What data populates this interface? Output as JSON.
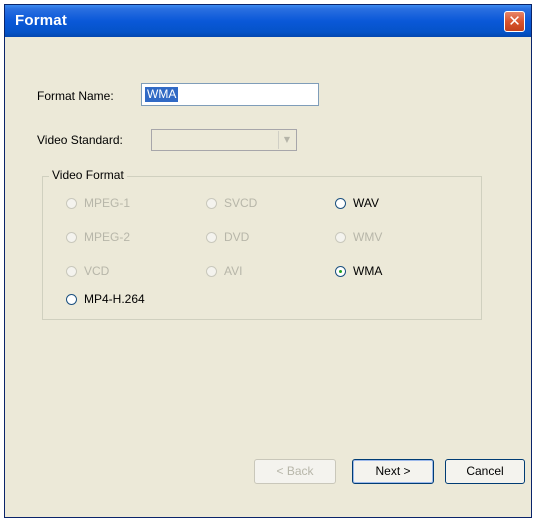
{
  "window": {
    "title": "Format",
    "close_glyph": "✕"
  },
  "form": {
    "format_name_label": "Format Name:",
    "format_name_value": "WMA",
    "video_standard_label": "Video Standard:",
    "video_standard_value": "",
    "dropdown_glyph": "▼"
  },
  "video_format": {
    "group_label": "Video Format",
    "options": [
      {
        "label": "MPEG-1",
        "enabled": false,
        "selected": false
      },
      {
        "label": "SVCD",
        "enabled": false,
        "selected": false
      },
      {
        "label": "WAV",
        "enabled": true,
        "selected": false
      },
      {
        "label": "MPEG-2",
        "enabled": false,
        "selected": false
      },
      {
        "label": "DVD",
        "enabled": false,
        "selected": false
      },
      {
        "label": "WMV",
        "enabled": false,
        "selected": false
      },
      {
        "label": "VCD",
        "enabled": false,
        "selected": false
      },
      {
        "label": "AVI",
        "enabled": false,
        "selected": false
      },
      {
        "label": "WMA",
        "enabled": true,
        "selected": true
      },
      {
        "label": "MP4-H.264",
        "enabled": true,
        "selected": false
      }
    ]
  },
  "buttons": {
    "back_label": "< Back",
    "next_label": "Next >",
    "cancel_label": "Cancel"
  },
  "colors": {
    "titlebar": "#0553c8",
    "dialog_background": "#ece9d8",
    "selection_highlight": "#316ac5",
    "radio_selected_dot": "#21a121"
  }
}
